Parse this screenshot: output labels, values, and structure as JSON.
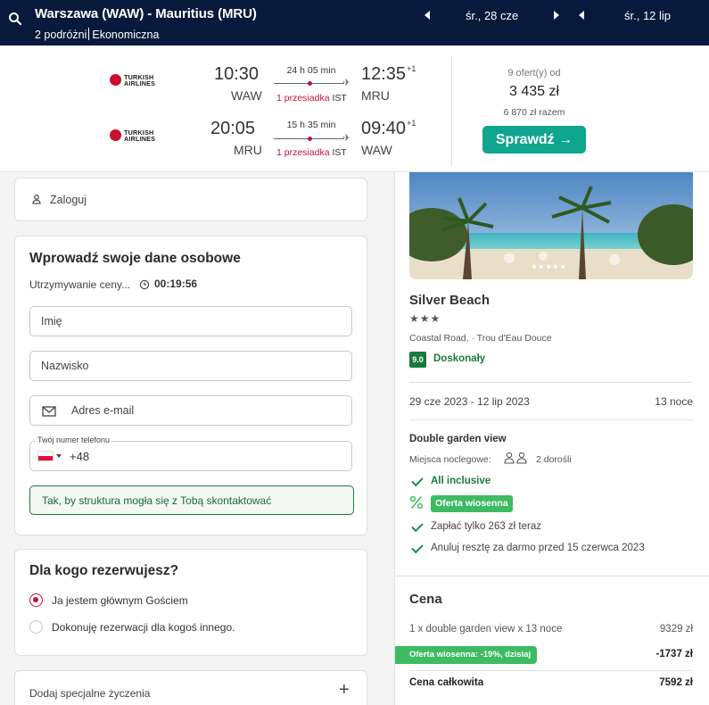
{
  "header": {
    "route": "Warszawa (WAW) - Mauritius (MRU)",
    "travellers": "2 podróżni",
    "cabin": "Ekonomiczna",
    "depart_date": "śr., 28 cze",
    "return_date": "śr., 12 lip"
  },
  "flights": [
    {
      "airline_line1": "TURKISH",
      "airline_line2": "AIRLINES",
      "dep_time": "10:30",
      "dep_code": "WAW",
      "duration": "24 h 05 min",
      "stops": "1 przesiadka",
      "via": "IST",
      "arr_time": "12:35",
      "arr_offset": "+1",
      "arr_code": "MRU"
    },
    {
      "airline_line1": "TURKISH",
      "airline_line2": "AIRLINES",
      "dep_time": "20:05",
      "dep_code": "MRU",
      "duration": "15 h 35 min",
      "stops": "1 przesiadka",
      "via": "IST",
      "arr_time": "09:40",
      "arr_offset": "+1",
      "arr_code": "WAW"
    }
  ],
  "offer": {
    "count_text": "9 ofert(y) od",
    "price": "3 435 zł",
    "total": "6 870 zł razem",
    "button": "Sprawdź →"
  },
  "login": {
    "label": "Zaloguj"
  },
  "personal": {
    "title": "Wprowadź swoje dane osobowe",
    "hold_text": "Utrzymywanie ceny...",
    "timer": "00:19:56",
    "first_name_ph": "Imię",
    "last_name_ph": "Nazwisko",
    "email_ph": "Adres e-mail",
    "phone_label": "Twój numer telefonu",
    "phone_prefix": "+48",
    "contact_note": "Tak, by struktura mogła się z Tobą skontaktować"
  },
  "booking_for": {
    "title": "Dla kogo rezerwujesz?",
    "option_main": "Ja jestem głównym Gościem",
    "option_other": "Dokonuję rezerwacji dla kogoś innego."
  },
  "special_requests": {
    "label": "Dodaj specjalne życzenia",
    "plus": "+"
  },
  "hotel": {
    "name": "Silver Beach",
    "stars": "★★★",
    "address": "Coastal Road, · Trou d'Eau Douce",
    "score": "9.0",
    "score_label": "Doskonały",
    "dates": "29 cze 2023 - 12 lip 2023",
    "nights": "13 noce",
    "room": "Double garden view",
    "sleeps_label": "Miejsca noclegowe:",
    "sleeps": "2 dorośli",
    "all_inclusive": "All inclusive",
    "promo": "Oferta wiosenna",
    "pay_now": "Zapłać tylko 263 zł teraz",
    "cancel": "Anuluj resztę za darmo przed 15 czerwca 2023"
  },
  "price": {
    "title": "Cena",
    "line_label": "1 x double garden view x 13 noce",
    "line_value": "9329 zł",
    "discount_label": "Oferta wiosenna: -19%, dzisiaj",
    "discount_value": "-1737 zł",
    "total_label": "Cena całkowita",
    "total_value": "7592 zł"
  },
  "colors": {
    "navy": "#071a3b",
    "teal": "#0fa58e",
    "green": "#1a8f4a",
    "accent": "#c4123e"
  }
}
